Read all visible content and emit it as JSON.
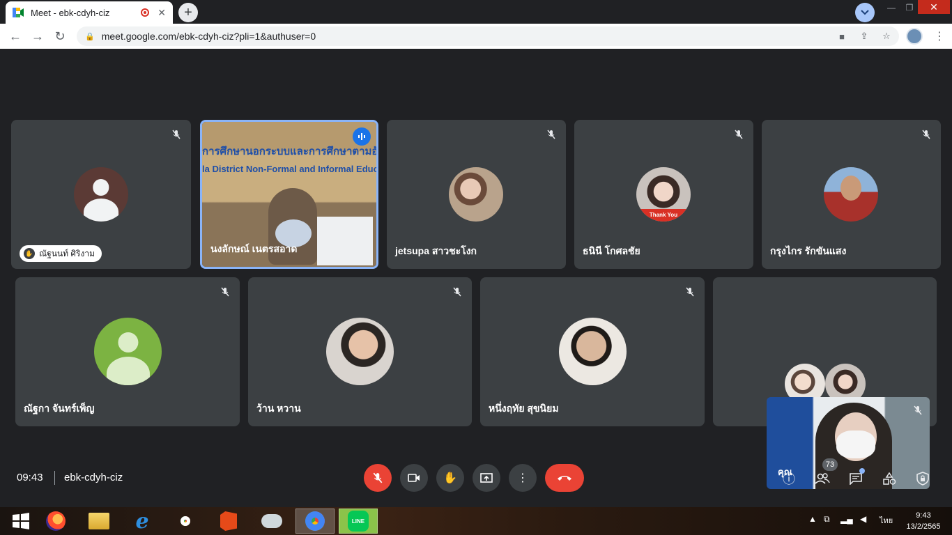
{
  "browser": {
    "tab_title": "Meet - ebk-cdyh-ciz",
    "tab_close": "✕",
    "new_tab": "+",
    "url": "meet.google.com/ebk-cdyh-ciz?pli=1&authuser=0"
  },
  "participants_row1": [
    {
      "name": "ณัฐนนท์ ศิริงาม",
      "avatar": "default",
      "hand_raised": true,
      "muted": true
    },
    {
      "name": "นงลักษณ์ เนตรสอาด",
      "avatar": "video",
      "speaking": true,
      "video_text_1": "การศึกษานอกระบบและการศึกษาตามอัธยาศัยอำเภ",
      "video_text_2": "la District Non-Formal and Informal Educatio"
    },
    {
      "name": "jetsupa สาวชะโงก",
      "avatar": "photo",
      "muted": true
    },
    {
      "name": "ธนินี โกศลชัย",
      "avatar": "photo",
      "muted": true,
      "photo_caption": "Thank You"
    },
    {
      "name": "กรุงไกร รักขันแสง",
      "avatar": "photo",
      "muted": true
    }
  ],
  "participants_row2": [
    {
      "name": "ณัฐกา จันทร์เพ็ญ",
      "avatar": "default-green",
      "muted": true
    },
    {
      "name": "ว้าน หวาน",
      "avatar": "photo",
      "muted": true
    },
    {
      "name": "หนึ่งฤทัย สุขนิยม",
      "avatar": "photo",
      "muted": true
    }
  ],
  "self_view": {
    "name": "คุณ"
  },
  "bottom_bar": {
    "time": "09:43",
    "meeting_code": "ebk-cdyh-ciz",
    "people_count": "73"
  },
  "icons": {
    "mic_off": "🎙",
    "camera": "▭",
    "raise_hand": "✋",
    "present": "⬆",
    "more": "⋮",
    "end_call": "☎",
    "info": "ⓘ",
    "people": "👥",
    "chat": "💬",
    "activities": "◭",
    "host_controls": "🛡"
  },
  "taskbar": {
    "lang": "ไทย",
    "clock_time": "9:43",
    "clock_date": "13/2/2565",
    "line_label": "LINE"
  },
  "colors": {
    "meet_bg": "#202124",
    "tile_bg": "#3c4043",
    "speaking_border": "#8ab4f8",
    "danger": "#ea4335"
  }
}
